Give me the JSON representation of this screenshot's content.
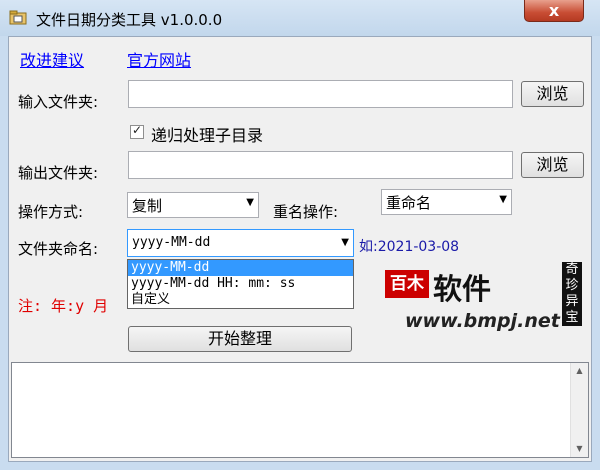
{
  "window": {
    "title": "文件日期分类工具 v1.0.0.0",
    "close_label": "x"
  },
  "links": {
    "suggest": "改进建议",
    "official_site": "官方网站"
  },
  "input_folder": {
    "label": "输入文件夹:",
    "value": "",
    "browse": "浏览"
  },
  "recursive": {
    "label": "递归处理子目录",
    "checked": true
  },
  "output_folder": {
    "label": "输出文件夹:",
    "value": "",
    "browse": "浏览"
  },
  "operation": {
    "label": "操作方式:",
    "selected": "复制"
  },
  "rename": {
    "label": "重名操作:",
    "selected": "重命名"
  },
  "folder_naming": {
    "label": "文件夹命名:",
    "selected": "yyyy-MM-dd",
    "example": "如:2021-03-08",
    "options": [
      "yyyy-MM-dd",
      "yyyy-MM-dd HH: mm: ss",
      "自定义"
    ]
  },
  "note": "注: 年:y 月",
  "start_button": "开始整理",
  "logo": {
    "text": "百木软件",
    "tag": "奇珍异宝",
    "url": "www.bmpj.net"
  }
}
